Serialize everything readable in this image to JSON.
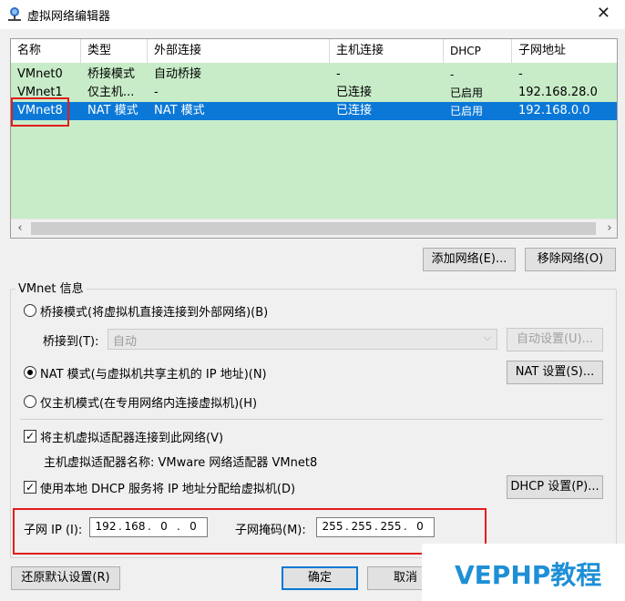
{
  "window": {
    "title": "虚拟网络编辑器"
  },
  "table": {
    "headers": [
      "名称",
      "类型",
      "外部连接",
      "主机连接",
      "DHCP",
      "子网地址"
    ],
    "rows": [
      [
        "VMnet0",
        "桥接模式",
        "自动桥接",
        "-",
        "-",
        "-"
      ],
      [
        "VMnet1",
        "仅主机...",
        "-",
        "已连接",
        "已启用",
        "192.168.28.0"
      ],
      [
        "VMnet8",
        "NAT 模式",
        "NAT 模式",
        "已连接",
        "已启用",
        "192.168.0.0"
      ]
    ],
    "selected_row": 2
  },
  "buttons": {
    "add_network": "添加网络(E)...",
    "remove_network": "移除网络(O)",
    "auto_settings": "自动设置(U)...",
    "nat_settings": "NAT 设置(S)...",
    "dhcp_settings": "DHCP 设置(P)...",
    "restore_defaults": "还原默认设置(R)",
    "ok": "确定",
    "cancel": "取消"
  },
  "vmnet_info": {
    "group_label": "VMnet 信息",
    "bridged_radio": "桥接模式(将虚拟机直接连接到外部网络)(B)",
    "bridged_to_label": "桥接到(T):",
    "bridged_to_value": "自动",
    "nat_radio": "NAT 模式(与虚拟机共享主机的 IP 地址)(N)",
    "hostonly_radio": "仅主机模式(在专用网络内连接虚拟机)(H)",
    "selected_mode": "nat",
    "connect_adapter_check": "将主机虚拟适配器连接到此网络(V)",
    "connect_adapter_checked": true,
    "adapter_name": "主机虚拟适配器名称: VMware 网络适配器 VMnet8",
    "use_dhcp_check": "使用本地 DHCP 服务将 IP 地址分配给虚拟机(D)",
    "use_dhcp_checked": true,
    "subnet_ip_label": "子网 IP (I):",
    "subnet_ip": [
      "192",
      "168",
      "0",
      "0"
    ],
    "subnet_mask_label": "子网掩码(M):",
    "subnet_mask": [
      "255",
      "255",
      "255",
      "0"
    ]
  },
  "watermark": "VEPHP教程",
  "colors": {
    "selection": "#0b78d7",
    "list_bg": "#c8ecc8",
    "highlight": "#e31c1c",
    "watermark": "#1f8fd6"
  }
}
